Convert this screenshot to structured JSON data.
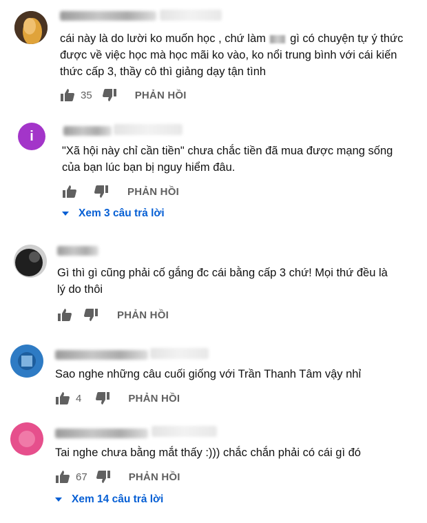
{
  "comments": [
    {
      "text_before": "cái này là do lười ko muốn học , chứ làm",
      "text_after": "gì có chuyện tự ý thức\nđược về việc học mà học mãi ko vào, ko nổi trung bình với cái kiến\nthức cấp 3, thầy cô thì giảng dạy tận tình",
      "likes": "35",
      "reply_label": "PHẢN HỒI",
      "avatar_color": "#e0a33a"
    },
    {
      "text": "\"Xã hội này chỉ cần tiền\" chưa chắc tiền đã mua được mạng sống\ncủa bạn lúc bạn bị nguy hiểm đâu.",
      "likes": "",
      "reply_label": "PHẢN HỒI",
      "avatar_letter": "i",
      "avatar_color": "#a335c9",
      "view_replies": "Xem 3 câu trả lời"
    },
    {
      "text": "Gì thì gì cũng phải cố gắng đc cái bằng cấp 3 chứ! Mọi thứ đều là\nlý do thôi",
      "likes": "",
      "reply_label": "PHẢN HỒI",
      "avatar_color": "#2a2a2a"
    },
    {
      "text": "Sao nghe những câu cuối giống với Trần Thanh Tâm vậy nhỉ",
      "likes": "4",
      "reply_label": "PHẢN HỒI",
      "avatar_color": "#2e7bc4"
    },
    {
      "text": "Tai nghe chưa bằng mắt thấy :))) chắc chắn phải có cái gì đó",
      "likes": "67",
      "reply_label": "PHẢN HỒI",
      "avatar_color": "#e64f8c",
      "view_replies": "Xem 14 câu trả lời"
    }
  ],
  "icons": {
    "like": "thumbs-up-icon",
    "dislike": "thumbs-down-icon",
    "expand": "caret-down-icon"
  }
}
